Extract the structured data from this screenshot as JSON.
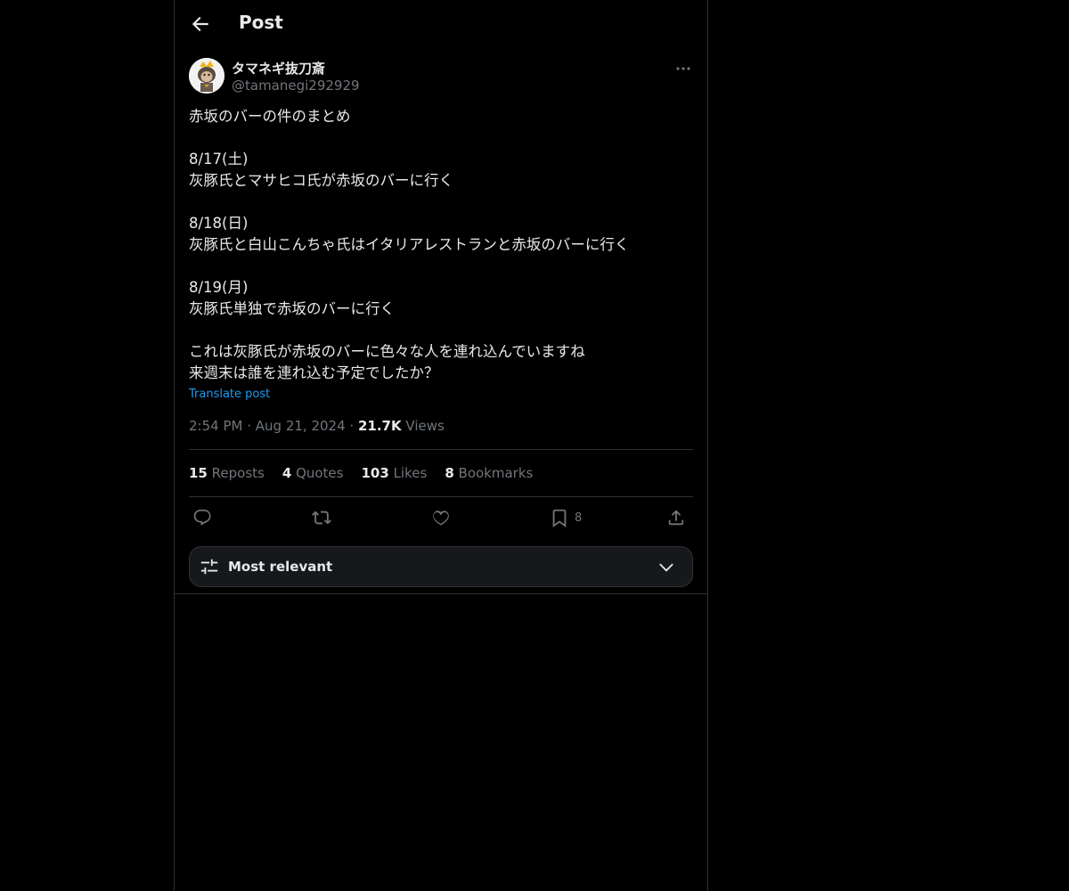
{
  "header": {
    "title": "Post"
  },
  "author": {
    "display_name": "タマネギ抜刀斎",
    "handle": "@tamanegi292929"
  },
  "post": {
    "text": "赤坂のバーの件のまとめ\n\n8/17(土)\n灰豚氏とマサヒコ氏が赤坂のバーに行く\n\n8/18(日)\n灰豚氏と白山こんちゃ氏はイタリアレストランと赤坂のバーに行く\n\n8/19(月)\n灰豚氏単独で赤坂のバーに行く\n\nこれは灰豚氏が赤坂のバーに色々な人を連れ込んでいますね\n来週末は誰を連れ込む予定でしたか？",
    "translate_label": "Translate post",
    "time": "2:54 PM",
    "date": "Aug 21, 2024",
    "views_count": "21.7K",
    "views_label": "Views"
  },
  "stats": {
    "reposts": {
      "count": "15",
      "label": "Reposts"
    },
    "quotes": {
      "count": "4",
      "label": "Quotes"
    },
    "likes": {
      "count": "103",
      "label": "Likes"
    },
    "bookmarks": {
      "count": "8",
      "label": "Bookmarks"
    }
  },
  "actions": {
    "reply_icon": "reply-icon",
    "repost_icon": "repost-icon",
    "like_icon": "heart-icon",
    "bookmark_icon": "bookmark-icon",
    "bookmark_count": "8",
    "share_icon": "share-icon"
  },
  "sort": {
    "label": "Most relevant"
  },
  "colors": {
    "background": "#000000",
    "text": "#e7e9ea",
    "muted": "#71767b",
    "link": "#1d9bf0",
    "border": "#2f3336"
  }
}
